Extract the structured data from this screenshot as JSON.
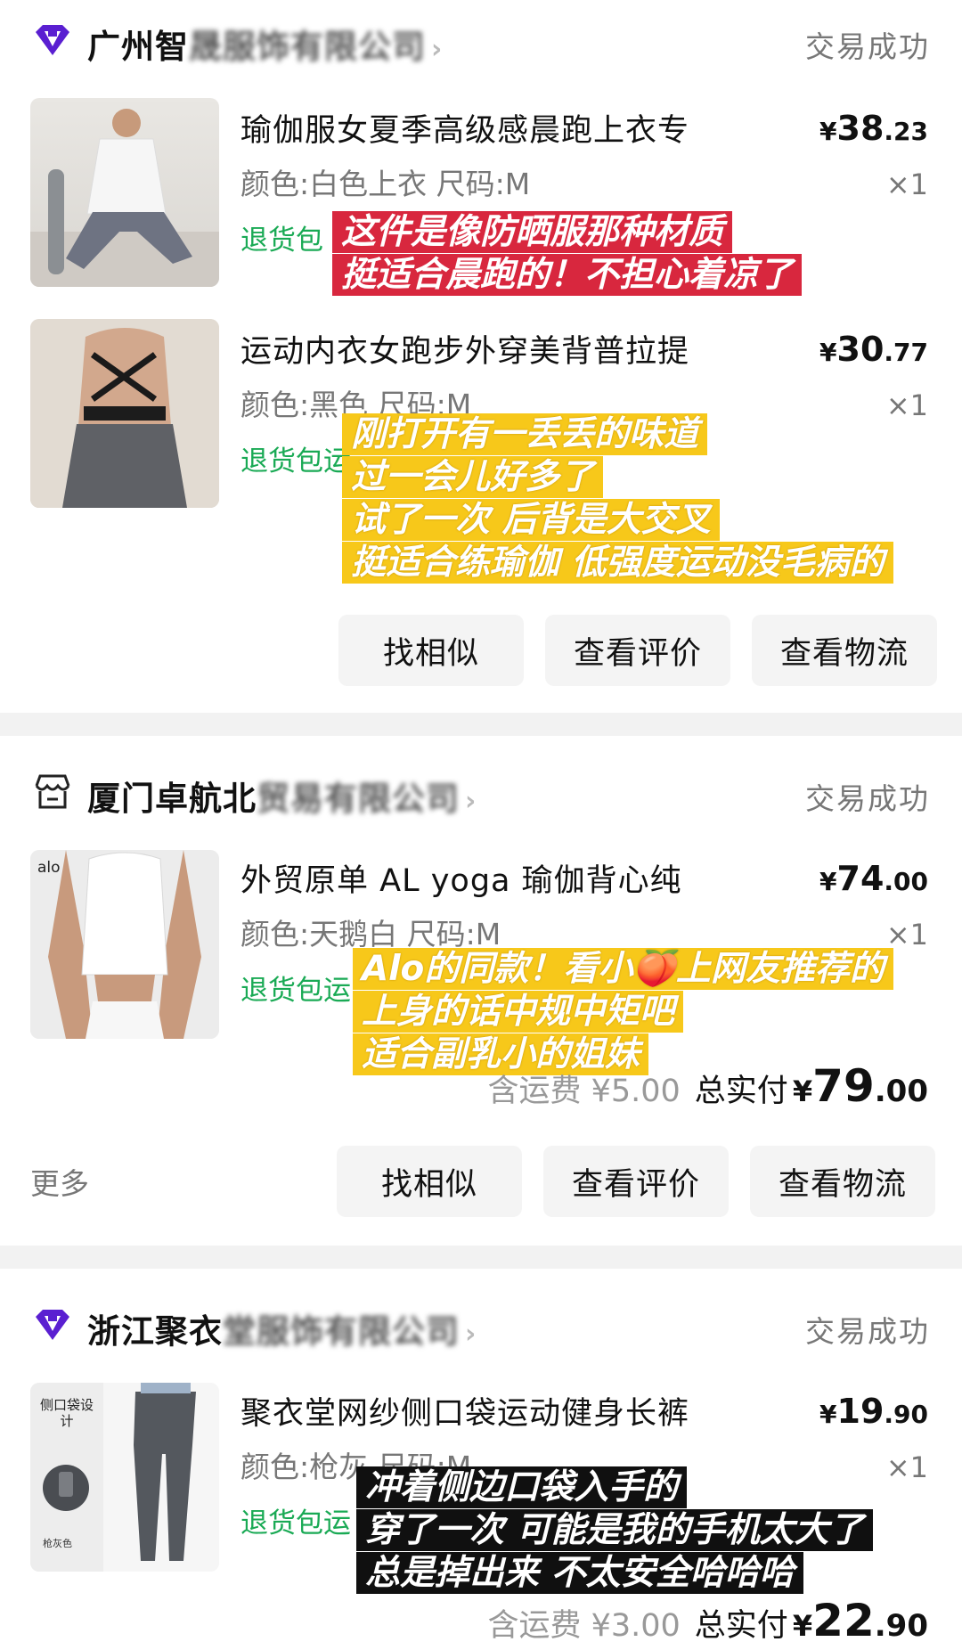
{
  "orders": [
    {
      "shop_name_visible": "广州智",
      "shop_name_blurred": "晟服饰有限公司",
      "status": "交易成功",
      "items": [
        {
          "title": "瑜伽服女夏季高级感晨跑上衣专",
          "spec": "颜色:白色上衣 尺码:M",
          "return_label": "退货包",
          "price_currency": "¥",
          "price_int": "38",
          "price_dec": ".23",
          "qty": "×1",
          "caption": [
            "这件是像防晒服那种材质",
            "挺适合晨跑的！不担心着凉了"
          ]
        },
        {
          "title": "运动内衣女跑步外穿美背普拉提",
          "spec": "颜色:黑色 尺码:M",
          "return_label": "退货包运",
          "price_currency": "¥",
          "price_int": "30",
          "price_dec": ".77",
          "qty": "×1",
          "caption": [
            "刚打开有一丢丢的味道",
            "过一会儿好多了",
            "试了一次 后背是大交叉",
            "挺适合练瑜伽 低强度运动没毛病的"
          ]
        }
      ],
      "buttons": [
        "找相似",
        "查看评价",
        "查看物流"
      ]
    },
    {
      "shop_name_visible": "厦门卓航北",
      "shop_name_blurred": "贸易有限公司",
      "status": "交易成功",
      "items": [
        {
          "title": "外贸原单 AL yoga 瑜伽背心纯",
          "spec": "颜色:天鹅白 尺码:M",
          "return_label": "退货包运",
          "price_currency": "¥",
          "price_int": "74",
          "price_dec": ".00",
          "qty": "×1",
          "thumb_logo": "alo",
          "caption": [
            "Alo的同款！看小🍑上网友推荐的",
            "上身的话中规中矩吧",
            "适合副乳小的姐妹"
          ]
        }
      ],
      "shipping": "含运费 ¥5.00",
      "total_label": "总实付",
      "total_currency": "¥",
      "total_int": "79",
      "total_dec": ".00",
      "more": "更多",
      "buttons": [
        "找相似",
        "查看评价",
        "查看物流"
      ]
    },
    {
      "shop_name_visible": "浙江聚衣",
      "shop_name_blurred": "堂服饰有限公司",
      "status": "交易成功",
      "items": [
        {
          "title": "聚衣堂网纱侧口袋运动健身长裤",
          "spec": "颜色:枪灰 尺码:M",
          "return_label": "退货包运",
          "price_currency": "¥",
          "price_int": "19",
          "price_dec": ".90",
          "qty": "×1",
          "thumb_text": "侧口袋设计",
          "thumb_color": "枪灰色",
          "caption": [
            "冲着侧边口袋入手的",
            "穿了一次 可能是我的手机太大了",
            "总是掉出来 不太安全哈哈哈"
          ]
        }
      ],
      "shipping": "含运费 ¥3.00",
      "total_label": "总实付",
      "total_currency": "¥",
      "total_int": "22",
      "total_dec": ".90"
    }
  ],
  "colors": {
    "accent_green": "#1aaa55",
    "shop_icon_purple": "#5a1fd1",
    "caption_red": "#d8273e",
    "caption_yellow": "#f7c81a"
  }
}
